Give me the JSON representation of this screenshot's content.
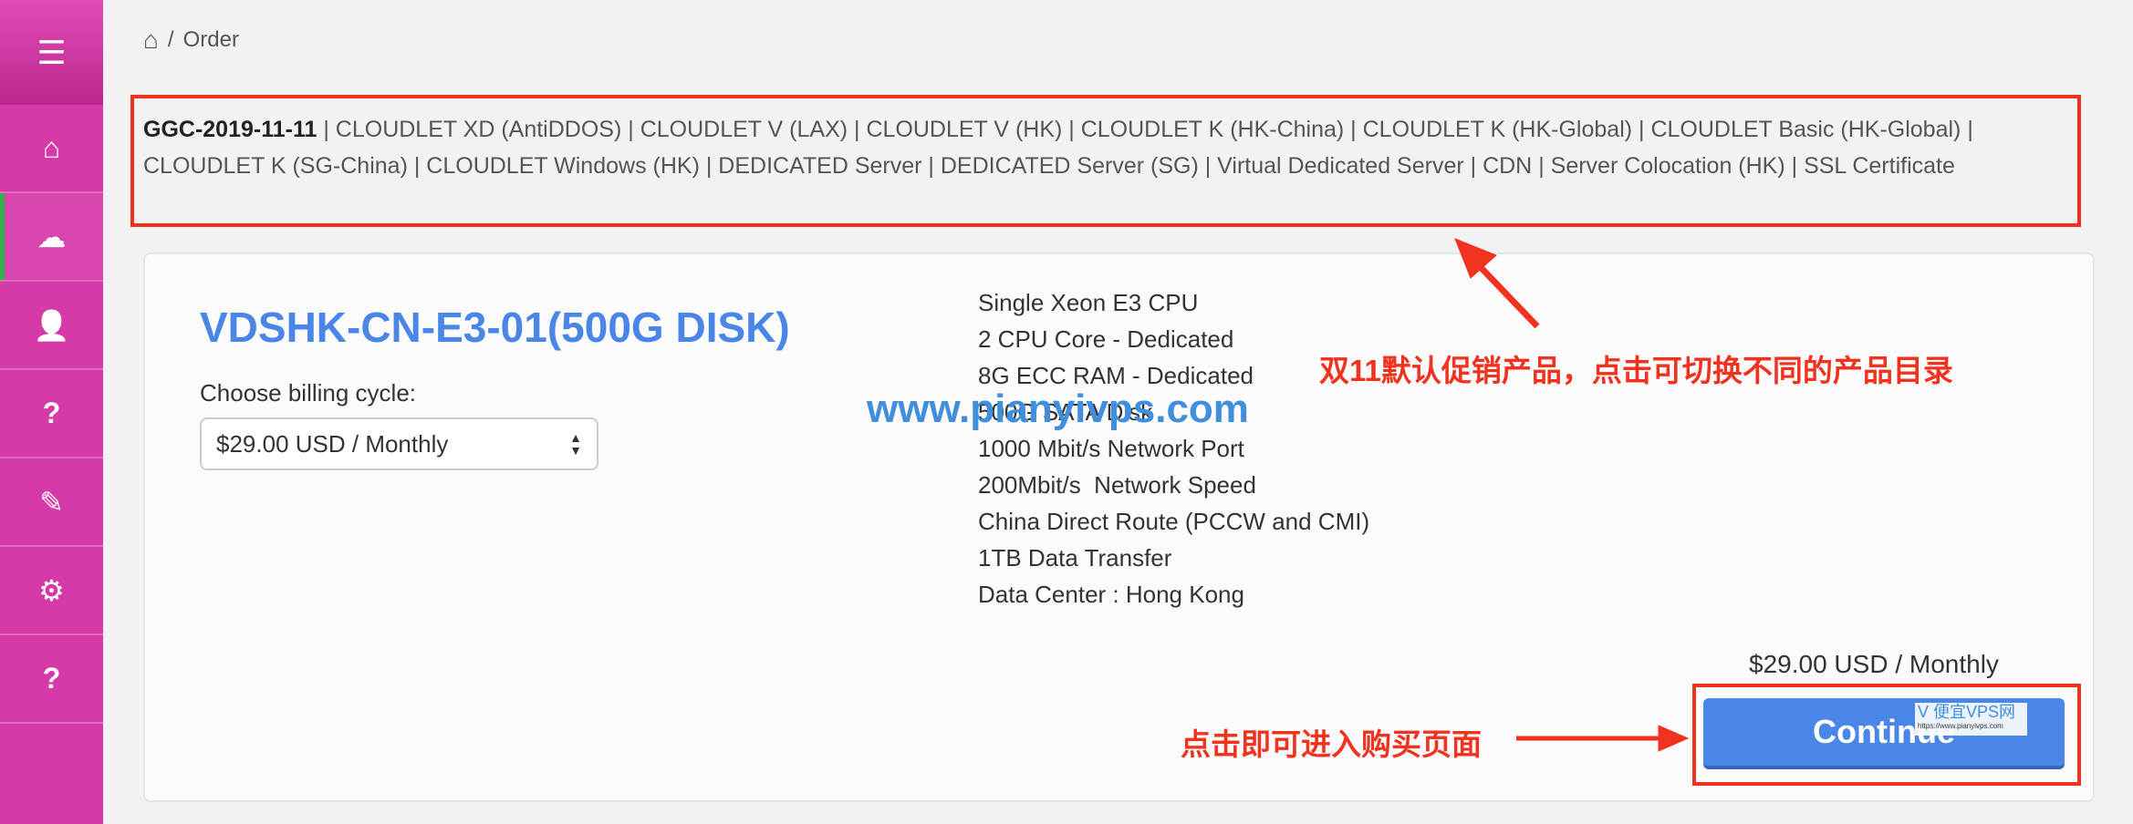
{
  "sidebar": {
    "items": [
      {
        "icon": "menu-icon",
        "glyph": "☰"
      },
      {
        "icon": "home-icon",
        "glyph": "⌂"
      },
      {
        "icon": "cloud-icon",
        "glyph": "☁",
        "active": true
      },
      {
        "icon": "user-icon",
        "glyph": "👤"
      },
      {
        "icon": "help-icon",
        "glyph": "?"
      },
      {
        "icon": "pencil-icon",
        "glyph": "✎"
      },
      {
        "icon": "gear-icon",
        "glyph": "⚙"
      },
      {
        "icon": "help-icon",
        "glyph": "?"
      }
    ]
  },
  "breadcrumb": {
    "sep": "/",
    "current": "Order"
  },
  "categories": [
    "GGC-2019-11-11",
    "CLOUDLET XD (AntiDDOS)",
    "CLOUDLET V (LAX)",
    "CLOUDLET V (HK)",
    "CLOUDLET K (HK-China)",
    "CLOUDLET K (HK-Global)",
    "CLOUDLET Basic (HK-Global)",
    "CLOUDLET K (SG-China)",
    "CLOUDLET Windows (HK)",
    "DEDICATED Server",
    "DEDICATED Server (SG)",
    "Virtual Dedicated Server",
    "CDN",
    "Server Colocation (HK)",
    "SSL Certificate"
  ],
  "product": {
    "title": "VDSHK-CN-E3-01(500G DISK)",
    "billing_label": "Choose billing cycle:",
    "billing_value": "$29.00 USD / Monthly",
    "features": [
      "Single Xeon E3 CPU",
      "2 CPU Core - Dedicated",
      "8G ECC RAM - Dedicated",
      "500G SATA Disk",
      "1000 Mbit/s Network Port",
      "200Mbit/s  Network Speed",
      "China Direct Route (PCCW and CMI)",
      "1TB Data Transfer",
      "Data Center : Hong Kong"
    ],
    "price": "$29.00 USD / Monthly",
    "continue_label": "Continue"
  },
  "annotations": {
    "note_categories": "双11默认促销产品，点击可切换不同的产品目录",
    "note_continue": "点击即可进入购买页面",
    "watermark": "www.pianyivps.com",
    "watermark_small": "V 便宜VPS网",
    "watermark_small_url": "https://www.pianyivps.com",
    "color": "#f0321e"
  }
}
